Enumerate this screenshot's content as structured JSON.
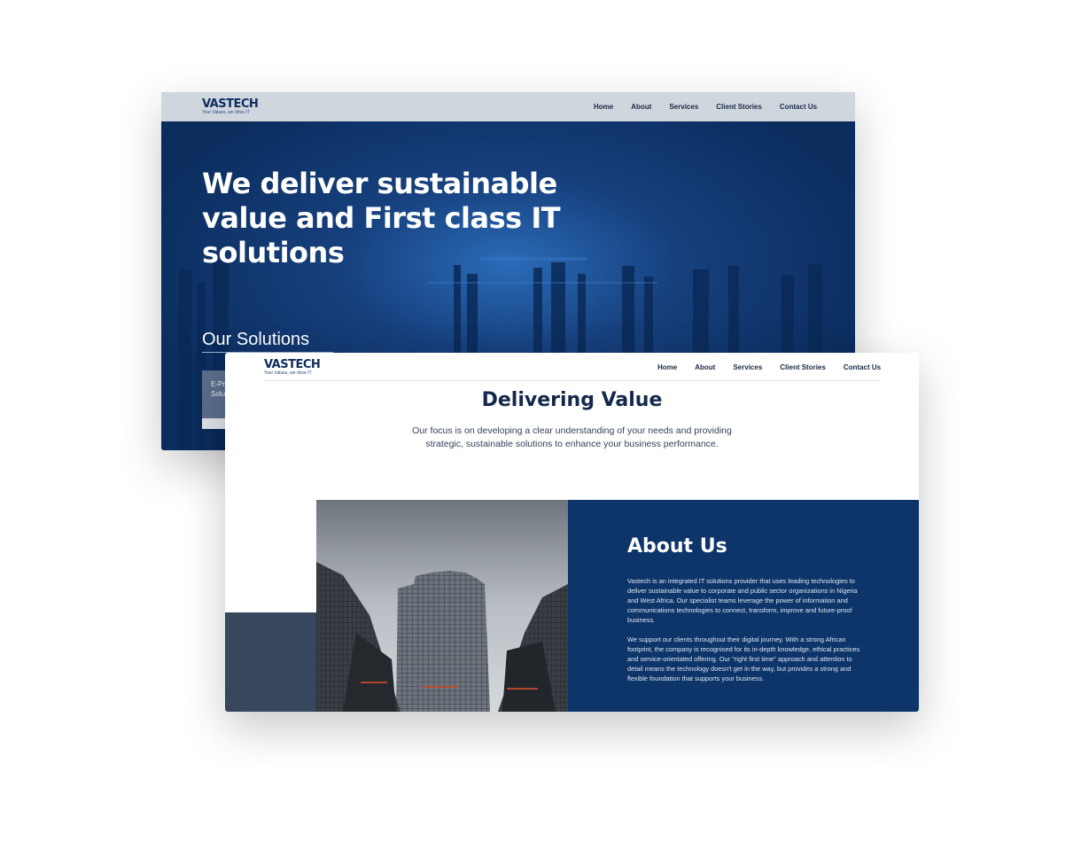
{
  "brand": {
    "name": "VASTECH",
    "tagline": "Your Values, we drive IT"
  },
  "nav": {
    "items": [
      "Home",
      "About",
      "Services",
      "Client Stories",
      "Contact Us"
    ]
  },
  "hero": {
    "title": "We deliver sustainable value and First class IT solutions"
  },
  "solutions": {
    "title": "Our Solutions",
    "card_line1": "E-Pr",
    "card_line2": "Solu"
  },
  "delivering": {
    "title": "Delivering Value",
    "text": "Our focus is on developing a clear understanding of your needs and providing strategic, sustainable solutions to enhance your business performance."
  },
  "about": {
    "title": "About Us",
    "paragraph1": "Vastech is an integrated IT solutions provider that uses leading technologies to deliver sustainable value to corporate and public sector organizations in Nigeria and West Africa. Our specialist teams leverage the power of information and communications technologies to connect, transform, improve and future-proof business.",
    "paragraph2": "We support our clients throughout their digital journey. With a strong African footprint, the company is recognised for its  in-depth knowledge, ethical practices and service-orientated offering. Our \"right first time\" approach and attention to detail means the technology doesn't get in the way, but provides a strong and flexible foundation that supports your business."
  },
  "colors": {
    "navy": "#0d3569",
    "dark_text": "#13284a",
    "nav_bg": "#cfd6de",
    "slate": "#37475e"
  }
}
